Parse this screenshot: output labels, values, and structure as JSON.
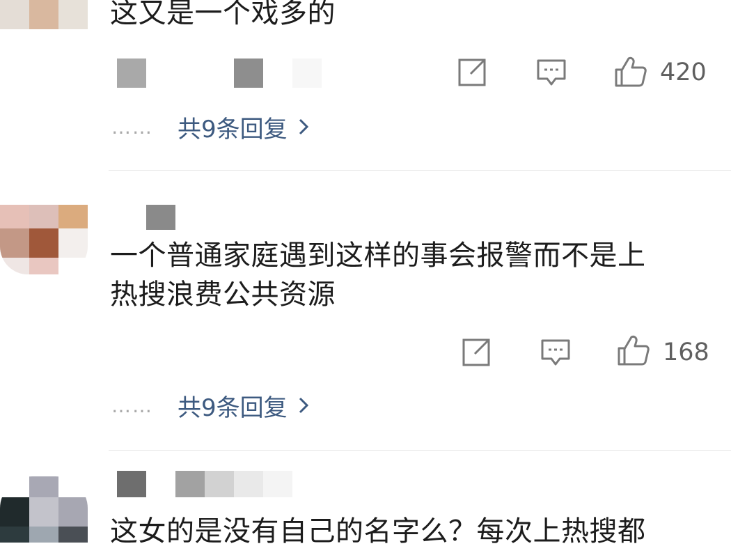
{
  "comments": [
    {
      "text_lines": [
        "这又是一个戏多的"
      ],
      "likes": "420",
      "replies_label": "共9条回复"
    },
    {
      "text_lines": [
        "一个普通家庭遇到这样的事会报警而不是上",
        "热搜浪费公共资源"
      ],
      "likes": "168",
      "replies_label": "共9条回复"
    },
    {
      "text_lines": [
        "这女的是没有自己的名字么？每次上热搜都"
      ]
    }
  ],
  "reply_prefix": "……",
  "icons": [
    "share-icon",
    "comment-icon",
    "like-icon",
    "chevron-right-icon"
  ],
  "colors": {
    "link": "#3d5a80",
    "text": "#1c1c1c",
    "muted": "#5f5f5f",
    "icon": "#7a7a7a"
  }
}
